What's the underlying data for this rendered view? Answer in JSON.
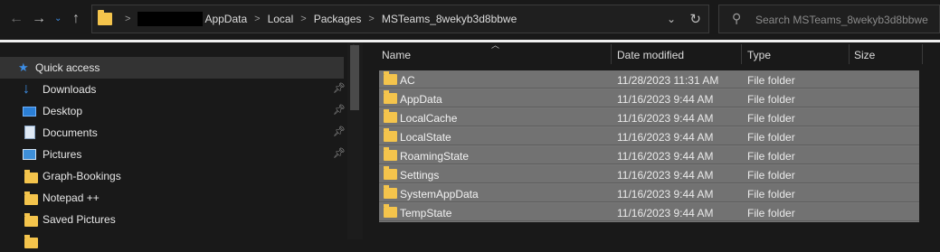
{
  "address": {
    "breadcrumbs": [
      "AppData",
      "Local",
      "Packages",
      "MSTeams_8wekyb3d8bbwe"
    ]
  },
  "search": {
    "placeholder": "Search MSTeams_8wekyb3d8bbwe"
  },
  "nav": {
    "items": [
      {
        "label": "Quick access",
        "icon": "star-icon",
        "pinned": false
      },
      {
        "label": "Downloads",
        "icon": "download-icon",
        "pinned": true
      },
      {
        "label": "Desktop",
        "icon": "desktop-icon",
        "pinned": true
      },
      {
        "label": "Documents",
        "icon": "documents-icon",
        "pinned": true
      },
      {
        "label": "Pictures",
        "icon": "pictures-icon",
        "pinned": true
      },
      {
        "label": "Graph-Bookings",
        "icon": "folder-icon",
        "pinned": false
      },
      {
        "label": "Notepad ++",
        "icon": "folder-icon",
        "pinned": false
      },
      {
        "label": "Saved Pictures",
        "icon": "folder-icon",
        "pinned": false
      }
    ]
  },
  "columns": {
    "name": "Name",
    "date": "Date modified",
    "type": "Type",
    "size": "Size"
  },
  "files": [
    {
      "name": "AC",
      "date": "11/28/2023 11:31 AM",
      "type": "File folder"
    },
    {
      "name": "AppData",
      "date": "11/16/2023 9:44 AM",
      "type": "File folder"
    },
    {
      "name": "LocalCache",
      "date": "11/16/2023 9:44 AM",
      "type": "File folder"
    },
    {
      "name": "LocalState",
      "date": "11/16/2023 9:44 AM",
      "type": "File folder"
    },
    {
      "name": "RoamingState",
      "date": "11/16/2023 9:44 AM",
      "type": "File folder"
    },
    {
      "name": "Settings",
      "date": "11/16/2023 9:44 AM",
      "type": "File folder"
    },
    {
      "name": "SystemAppData",
      "date": "11/16/2023 9:44 AM",
      "type": "File folder"
    },
    {
      "name": "TempState",
      "date": "11/16/2023 9:44 AM",
      "type": "File folder"
    }
  ],
  "colors": {
    "folder": "#f4c44c",
    "accent": "#3d8ee6",
    "selection": "#727272",
    "background": "#191919"
  }
}
